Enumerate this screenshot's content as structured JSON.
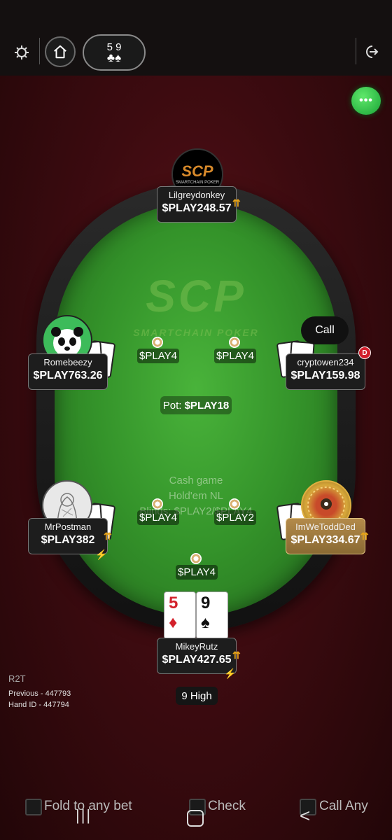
{
  "topbar": {
    "settings_icon": "gear-icon",
    "home_icon": "home-icon",
    "hand_cards": {
      "ranks": "5 9",
      "suits": "♣♠"
    },
    "exit_icon": "exit-icon"
  },
  "chat": {
    "icon": "chat-bubble-icon",
    "dots": "•••"
  },
  "table": {
    "watermark_logo": "SCP",
    "watermark_sub": "SMARTCHAIN POKER",
    "pot_label": "Pot:",
    "pot_value": "$PLAY18",
    "info_line1": "Cash game",
    "info_line2": "Hold'em NL",
    "info_line3": "Blinds: $PLAY2/$PLAY4"
  },
  "players": {
    "top": {
      "name": "Lilgreydonkey",
      "stack": "$PLAY248.57",
      "avatar_text": "SCP",
      "avatar_sub": "SMARTCHAIN POKER"
    },
    "left_upper": {
      "name": "Romebeezy",
      "stack": "$PLAY763.26",
      "avatar": "panda-avatar"
    },
    "right_upper": {
      "name": "cryptowen234",
      "stack": "$PLAY159.98",
      "action": "Call",
      "dealer": "D"
    },
    "left_lower": {
      "name": "MrPostman",
      "stack": "$PLAY382",
      "avatar": "sketch-avatar"
    },
    "right_lower": {
      "name": "ImWeToddDed",
      "stack": "$PLAY334.67",
      "avatar": "gold-coin-avatar"
    },
    "hero": {
      "name": "MikeyRutz",
      "stack": "$PLAY427.65",
      "hand_rank": "9 High"
    }
  },
  "bets": {
    "left_upper": "$PLAY4",
    "right_upper": "$PLAY4",
    "left_lower": "$PLAY4",
    "right_lower": "$PLAY2",
    "hero": "$PLAY4"
  },
  "hero_cards": [
    {
      "rank": "5",
      "suit": "♦",
      "color": "#d3212b"
    },
    {
      "rank": "9",
      "suit": "♠",
      "color": "#111111"
    }
  ],
  "footer_info": {
    "r2t": "R2T",
    "previous": "Previous - 447793",
    "hand_id": "Hand ID - 447794"
  },
  "controls": {
    "fold": "Fold to any bet",
    "check": "Check",
    "call": "Call Any"
  },
  "nav": {
    "recent": "|||",
    "home": "○",
    "back": "<"
  },
  "colors": {
    "felt": "#34932a",
    "background": "#3d0b10",
    "accent_gold": "#e6a318",
    "highlight_plate": "#c9a35a"
  }
}
